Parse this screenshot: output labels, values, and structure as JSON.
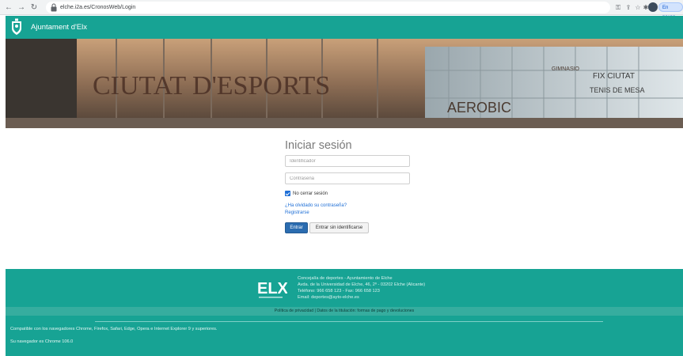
{
  "browser": {
    "url": "elche.i2a.es/CronosWeb/Login",
    "profile_status": "En pausa"
  },
  "header": {
    "brand": "Ajuntament d'Elx"
  },
  "banner": {
    "title": "CIUTAT D'ESPORTS",
    "sign_aerobic": "AEROBIC",
    "sign_gym": "GIMNASIO",
    "sign_fitness": "FIX CIUTAT",
    "sign_tennis": "TENIS DE MESA"
  },
  "login": {
    "title": "Iniciar sesión",
    "username_placeholder": "Identificador",
    "password_placeholder": "Contraseña",
    "remember_label": "No cerrar sesión",
    "remember_checked": true,
    "forgot_link": "¿Ha olvidado su contraseña?",
    "register_link": "Registrarse",
    "submit_label": "Entrar",
    "guest_label": "Entrar sin identificarse"
  },
  "footer": {
    "info_lines": [
      "Concejalía de deportes - Ayuntamiento de Elche",
      "Avda. de la Universidad de Elche, 46, 2º - 03202 Elche (Alicante)",
      "Teléfono: 966 658 123 - Fax: 966 658 123",
      "Email: deportes@ayto-elche.es"
    ],
    "links_text": "Política de privacidad | Datos de la titulación: formas de pago y devoluciones",
    "compat_text": "Compatible con los navegadores Chrome, Firefox, Safari, Edge, Opera e Internet Explorer 9 y superiores.",
    "browser_text": "Su navegador es Chrome 106.0"
  },
  "colors": {
    "brand_teal": "#17a394",
    "link_blue": "#1f6fd6",
    "primary_button": "#2b6cb0"
  }
}
